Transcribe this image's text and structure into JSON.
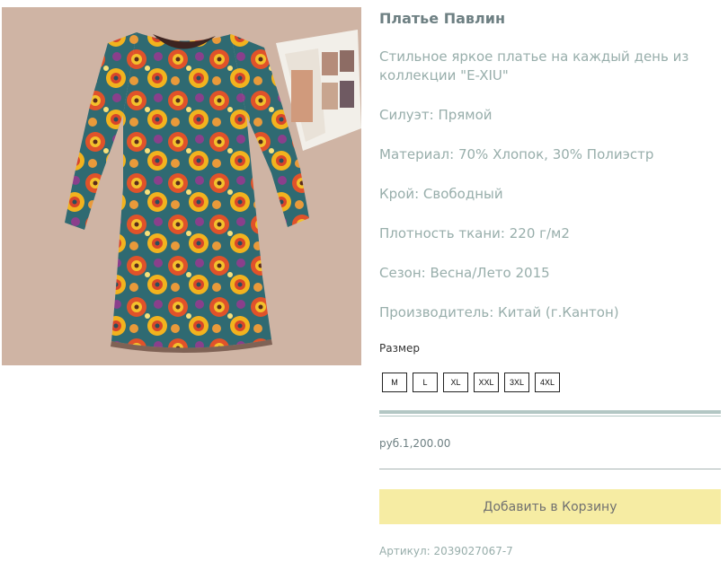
{
  "product": {
    "image_alt": "Платье Павлин",
    "title": "Платье Павлин",
    "description": "Стильное яркое платье на каждый день из коллекции \"E-XIU\"",
    "attributes": [
      "Силуэт: Прямой",
      "Материал: 70% Хлопок, 30% Полиэстр",
      "Крой: Свободный",
      "Плотность ткани: 220 г/м2",
      "Сезон: Весна/Лето 2015",
      "Производитель: Китай (г.Кантон)"
    ],
    "size_label": "Размер",
    "sizes": [
      "M",
      "L",
      "XL",
      "XXL",
      "3XL",
      "4XL"
    ],
    "price": "руб.1,200.00",
    "add_to_cart_label": "Добавить в Корзину",
    "sku": "Артикул: 2039027067-7"
  },
  "colors": {
    "text_muted": "#98aeab",
    "title": "#6e8083",
    "divider": "#b3c7c4",
    "cart_button_bg": "#f6eca3",
    "photo_background": "#cfb4a4"
  }
}
